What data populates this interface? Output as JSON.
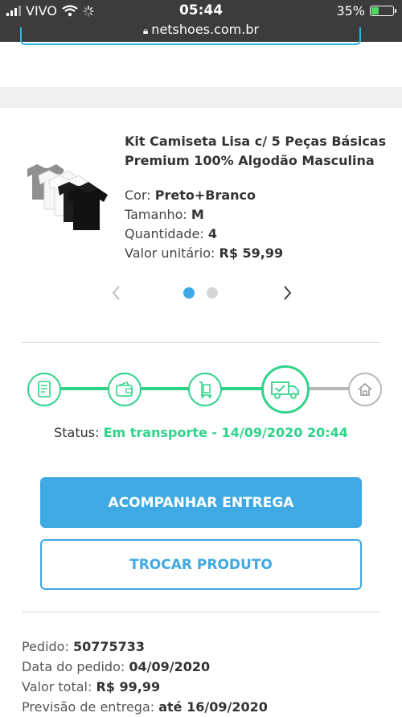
{
  "status_bar": {
    "carrier": "VIVO",
    "time": "05:44",
    "battery": "35%",
    "battery_level": 0.35,
    "url": "netshoes.com.br"
  },
  "product": {
    "title": "Kit Camiseta Lisa c/ 5 Peças Básicas Premium 100% Algodão Masculina",
    "color_label": "Cor:",
    "color_value": "Preto+Branco",
    "size_label": "Tamanho:",
    "size_value": "M",
    "quantity_label": "Quantidade:",
    "quantity_value": "4",
    "unit_price_label": "Valor unitário:",
    "unit_price_value": "R$ 59,99",
    "carousel_total": 2,
    "carousel_active": 1
  },
  "tracking": {
    "steps": [
      "order-received-icon",
      "payment-wallet-icon",
      "handling-cart-icon",
      "delivery-truck-icon",
      "home-icon"
    ],
    "current_step": 4,
    "status_label": "Status:",
    "status_value": "Em transporte - 14/09/2020 20:44",
    "active_color": "#2ed38a",
    "inactive_color": "#b8b8b8"
  },
  "actions": {
    "track_label": "ACOMPANHAR ENTREGA",
    "exchange_label": "TROCAR PRODUTO"
  },
  "order": {
    "number_label": "Pedido:",
    "number_value": "50775733",
    "date_label": "Data do pedido:",
    "date_value": "04/09/2020",
    "total_label": "Valor total:",
    "total_value": "R$ 99,99",
    "forecast_label": "Previsão de entrega:",
    "forecast_value": "até 16/09/2020"
  },
  "colors": {
    "accent": "#3fa9e3",
    "success": "#2ed38a"
  }
}
